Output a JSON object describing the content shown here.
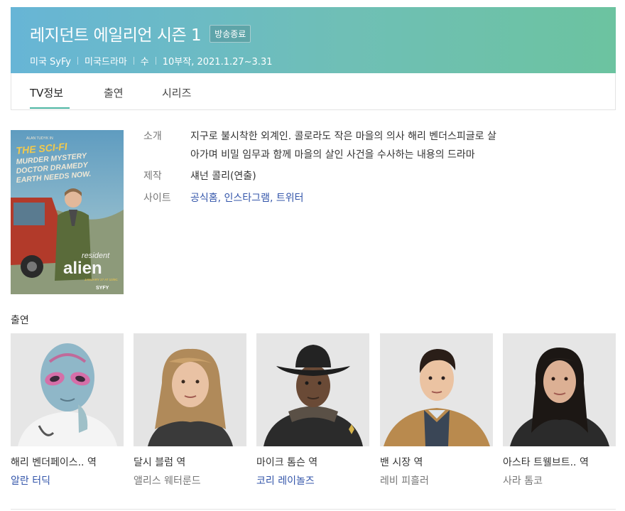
{
  "header": {
    "title": "레지던트 에일리언 시즌 1",
    "status_badge": "방송종료",
    "meta": [
      "미국 SyFy",
      "미국드라마",
      "수",
      "10부작, 2021.1.27~3.31"
    ],
    "gradient": [
      "#67b5d6",
      "#6cc3a0"
    ]
  },
  "tabs": [
    "TV정보",
    "출연",
    "시리즈"
  ],
  "poster": {
    "top_text": "ALAN TUDYK IN",
    "tagline": [
      "THE SCI-FI",
      "MURDER MYSTERY",
      "DOCTOR DRAMEDY",
      "EARTH NEEDS NOW."
    ],
    "logo": [
      "resident",
      "alien"
    ],
    "date": "JANUARY 27 AT 10/9C",
    "network": "SYFY"
  },
  "info": {
    "synopsis_label": "소개",
    "synopsis": [
      "지구로 불시착한 외계인. 콜로라도 작은 마을의 의사 해리 벤더스피글로 살",
      "아가며 비밀 임무과 함께 마을의 살인 사건을 수사하는 내용의 드라마"
    ],
    "production_label": "제작",
    "production": "섀넌 콜리(연출)",
    "site_label": "사이트",
    "sites": [
      "공식홈",
      "인스타그램",
      "트위터"
    ],
    "site_sep": ", "
  },
  "cast_section_title": "출연",
  "cast": [
    {
      "role": "해리 벤더페이스.. 역",
      "actor": "알란 터딕",
      "linked": true,
      "photo_icon": "alien-portrait"
    },
    {
      "role": "달시 블럼 역",
      "actor": "앨리스 웨터룬드",
      "linked": false,
      "photo_icon": "woman-blonde-portrait"
    },
    {
      "role": "마이크 톰슨 역",
      "actor": "코리 레이놀즈",
      "linked": true,
      "photo_icon": "sheriff-cowboy-hat-portrait"
    },
    {
      "role": "밴 시장 역",
      "actor": "레비 피흘러",
      "linked": false,
      "photo_icon": "young-man-portrait"
    },
    {
      "role": "아스타 트웰브트.. 역",
      "actor": "사라 톰코",
      "linked": false,
      "photo_icon": "woman-dark-hair-portrait"
    }
  ],
  "colors": {
    "accent": "#4cb5a3",
    "link": "#3355aa"
  }
}
